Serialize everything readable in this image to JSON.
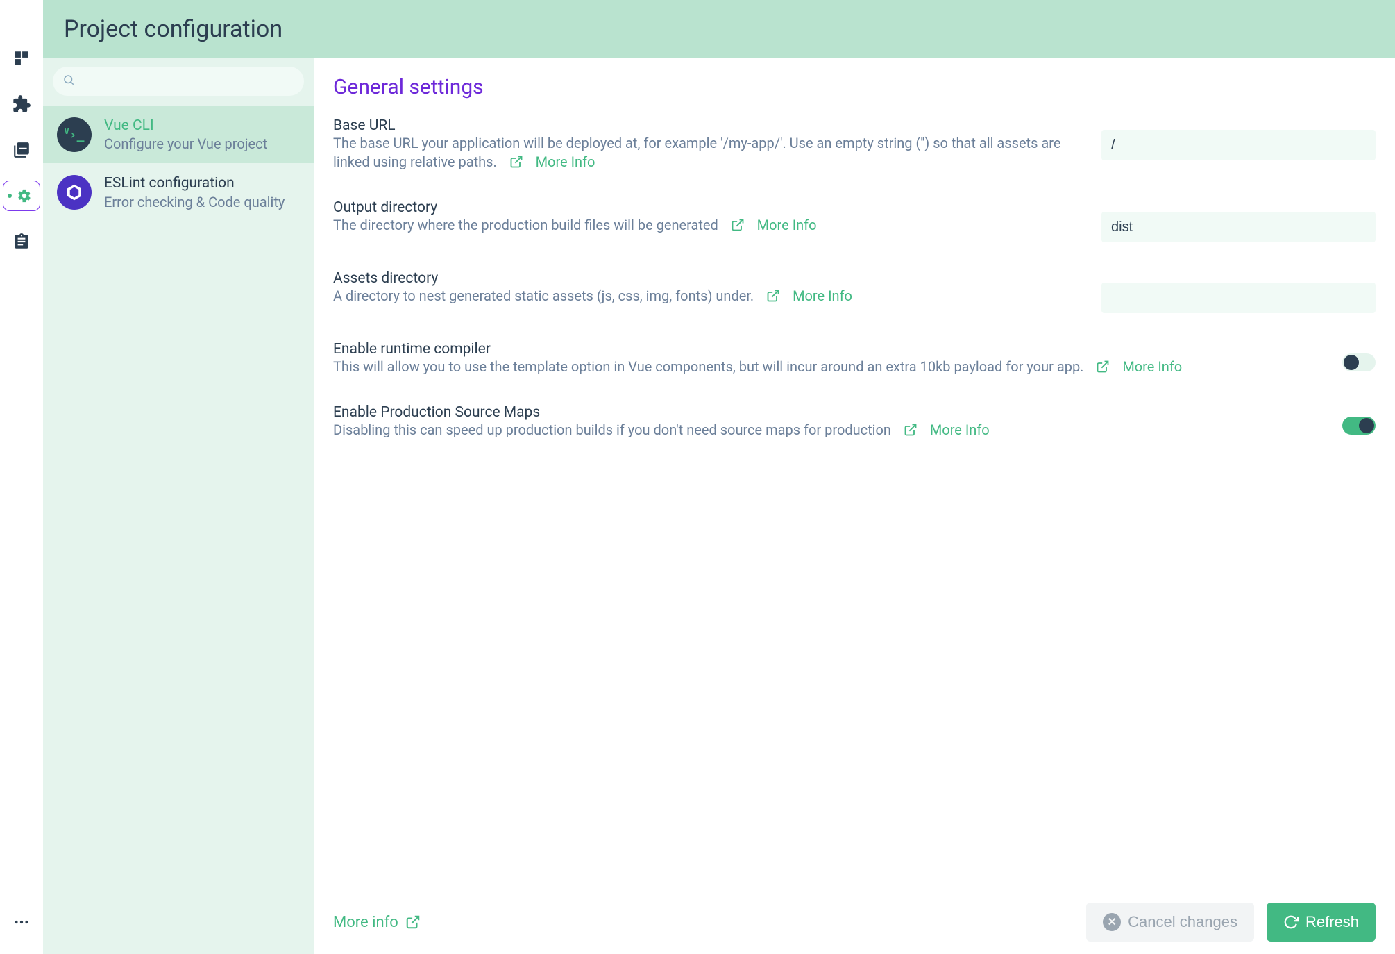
{
  "page_title": "Project configuration",
  "nav_icons": [
    "dashboard",
    "plugins",
    "dependencies",
    "configuration",
    "tasks"
  ],
  "search_placeholder": "",
  "config_items": [
    {
      "id": "vue-cli",
      "name": "Vue CLI",
      "desc": "Configure your Vue project",
      "icon": "vue",
      "active": true
    },
    {
      "id": "eslint",
      "name": "ESLint configuration",
      "desc": "Error checking & Code quality",
      "icon": "eslint",
      "active": false
    }
  ],
  "panel_heading": "General settings",
  "more_info_label": "More Info",
  "settings": [
    {
      "key": "baseUrl",
      "label": "Base URL",
      "desc": "The base URL your application will be deployed at, for example '/my-app/'. Use an empty string ('') so that all assets are linked using relative paths.",
      "type": "text",
      "value": "/"
    },
    {
      "key": "outputDir",
      "label": "Output directory",
      "desc": "The directory where the production build files will be generated",
      "type": "text",
      "value": "dist"
    },
    {
      "key": "assetsDir",
      "label": "Assets directory",
      "desc": "A directory to nest generated static assets (js, css, img, fonts) under.",
      "type": "text",
      "value": ""
    },
    {
      "key": "runtimeCompiler",
      "label": "Enable runtime compiler",
      "desc": "This will allow you to use the template option in Vue components, but will incur around an extra 10kb payload for your app.",
      "type": "toggle",
      "value": false
    },
    {
      "key": "productionSourceMap",
      "label": "Enable Production Source Maps",
      "desc": "Disabling this can speed up production builds if you don't need source maps for production",
      "type": "toggle",
      "value": true
    }
  ],
  "footer": {
    "more_info": "More info",
    "cancel": "Cancel changes",
    "refresh": "Refresh"
  }
}
